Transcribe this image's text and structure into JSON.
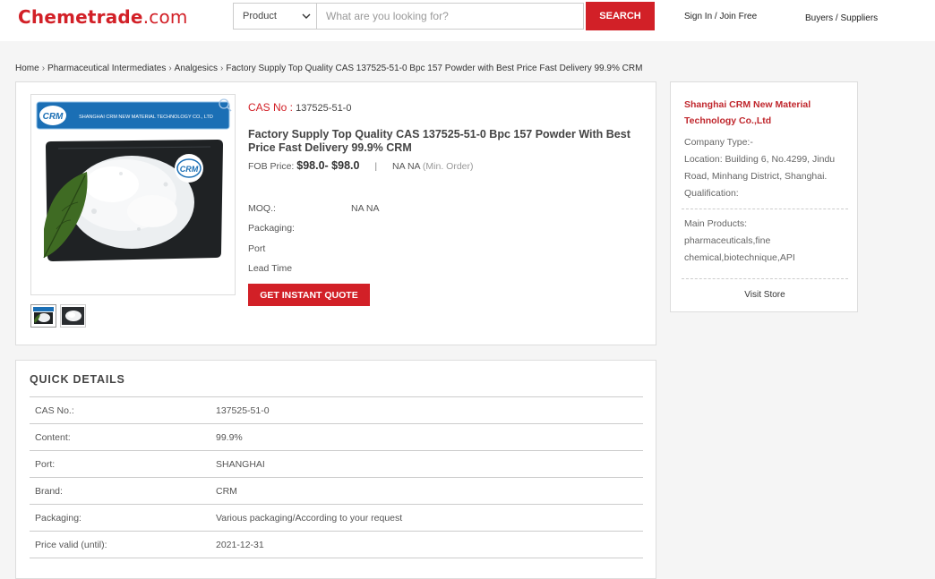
{
  "header": {
    "logo_main": "Chemetrade",
    "logo_tld": ".com",
    "search_category": "Product",
    "search_placeholder": "What are you looking for?",
    "search_button": "SEARCH",
    "signin": "Sign In / Join Free",
    "buyers_suppliers": "Buyers / Suppliers"
  },
  "breadcrumb": {
    "items": [
      "Home",
      "Pharmaceutical Intermediates",
      "Analgesics",
      "Factory Supply Top Quality CAS 137525-51-0 Bpc 157 Powder with Best Price Fast Delivery 99.9% CRM"
    ],
    "separator": "›"
  },
  "product": {
    "cas_label": "CAS No :",
    "cas_value": "137525-51-0",
    "title": "Factory Supply Top Quality CAS 137525-51-0 Bpc 157 Powder With Best Price Fast Delivery 99.9% CRM",
    "fob_label": "FOB Price:",
    "price": "$98.0- $98.0",
    "bar": "|",
    "min_qty": "NA NA",
    "min_order": "(Min. Order)",
    "moq_label": "MOQ.:",
    "moq_value": "NA NA",
    "packaging_label": "Packaging:",
    "port_label": "Port",
    "lead_time_label": "Lead Time",
    "quote_button": "GET INSTANT QUOTE",
    "image_banner_text": "SHANGHAI CRM NEW MATERIAL TECHNOLOGY CO., LTD",
    "image_logo_text": "CRM"
  },
  "supplier": {
    "name": "Shanghai CRM New Material Technology Co.,Ltd",
    "company_type": "Company Type:-",
    "location": "Location: Building 6, No.4299, Jindu Road, Minhang District, Shanghai.",
    "qualification": "Qualification:",
    "main_products_label": "Main Products:",
    "main_products": "pharmaceuticals,fine chemical,biotechnique,API",
    "visit_store": "Visit Store"
  },
  "quick_details": {
    "title": "QUICK DETAILS",
    "rows": [
      {
        "key": "CAS No.:",
        "value": "137525-51-0"
      },
      {
        "key": "Content:",
        "value": "99.9%"
      },
      {
        "key": "Port:",
        "value": "SHANGHAI"
      },
      {
        "key": "Brand:",
        "value": "CRM"
      },
      {
        "key": "Packaging:",
        "value": "Various packaging/According to your request"
      },
      {
        "key": "Price valid (until):",
        "value": "2021-12-31"
      }
    ]
  },
  "colors": {
    "brand_red": "#d22027",
    "supplier_red": "#c0272d",
    "image_banner_blue": "#1b6fb5"
  }
}
